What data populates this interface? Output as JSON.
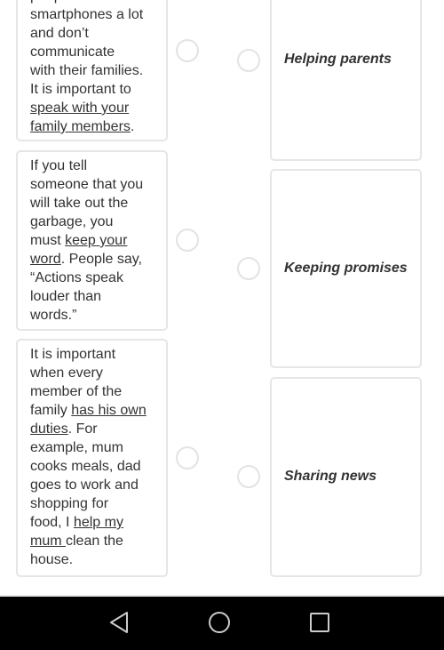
{
  "statements": [
    {
      "lines": [
        [
          {
            "t": "people use"
          }
        ],
        [
          {
            "t": "smartphones a lot"
          }
        ],
        [
          {
            "t": "and don’t"
          }
        ],
        [
          {
            "t": "communicate"
          }
        ],
        [
          {
            "t": "with their families."
          }
        ],
        [
          {
            "t": "It is important to"
          }
        ],
        [
          {
            "t": "speak with your",
            "u": true
          }
        ],
        [
          {
            "t": "family members",
            "u": true
          },
          {
            "t": "."
          }
        ]
      ]
    },
    {
      "lines": [
        [
          {
            "t": "If you tell"
          }
        ],
        [
          {
            "t": "someone that you"
          }
        ],
        [
          {
            "t": "will take out the"
          }
        ],
        [
          {
            "t": "garbage, you"
          }
        ],
        [
          {
            "t": "must "
          },
          {
            "t": "keep your",
            "u": true
          }
        ],
        [
          {
            "t": "word",
            "u": true
          },
          {
            "t": ". People say,"
          }
        ],
        [
          {
            "t": "“Actions speak"
          }
        ],
        [
          {
            "t": "louder than"
          }
        ],
        [
          {
            "t": "words.”"
          }
        ]
      ]
    },
    {
      "lines": [
        [
          {
            "t": "It is important"
          }
        ],
        [
          {
            "t": "when every"
          }
        ],
        [
          {
            "t": "member of the"
          }
        ],
        [
          {
            "t": "family "
          },
          {
            "t": "has his own",
            "u": true
          }
        ],
        [
          {
            "t": "duties",
            "u": true
          },
          {
            "t": ". For"
          }
        ],
        [
          {
            "t": "example, mum"
          }
        ],
        [
          {
            "t": "cooks meals, dad"
          }
        ],
        [
          {
            "t": "goes to work and"
          }
        ],
        [
          {
            "t": "shopping for"
          }
        ],
        [
          {
            "t": "food, I "
          },
          {
            "t": "help my",
            "u": true
          }
        ],
        [
          {
            "t": "mum ",
            "u": true
          },
          {
            "t": "clean the"
          }
        ],
        [
          {
            "t": "house."
          }
        ]
      ]
    }
  ],
  "answers": [
    "Helping parents",
    "Keeping promises",
    "Sharing news"
  ],
  "nav": {
    "back": "back-icon",
    "home": "home-icon",
    "recents": "recents-icon"
  }
}
